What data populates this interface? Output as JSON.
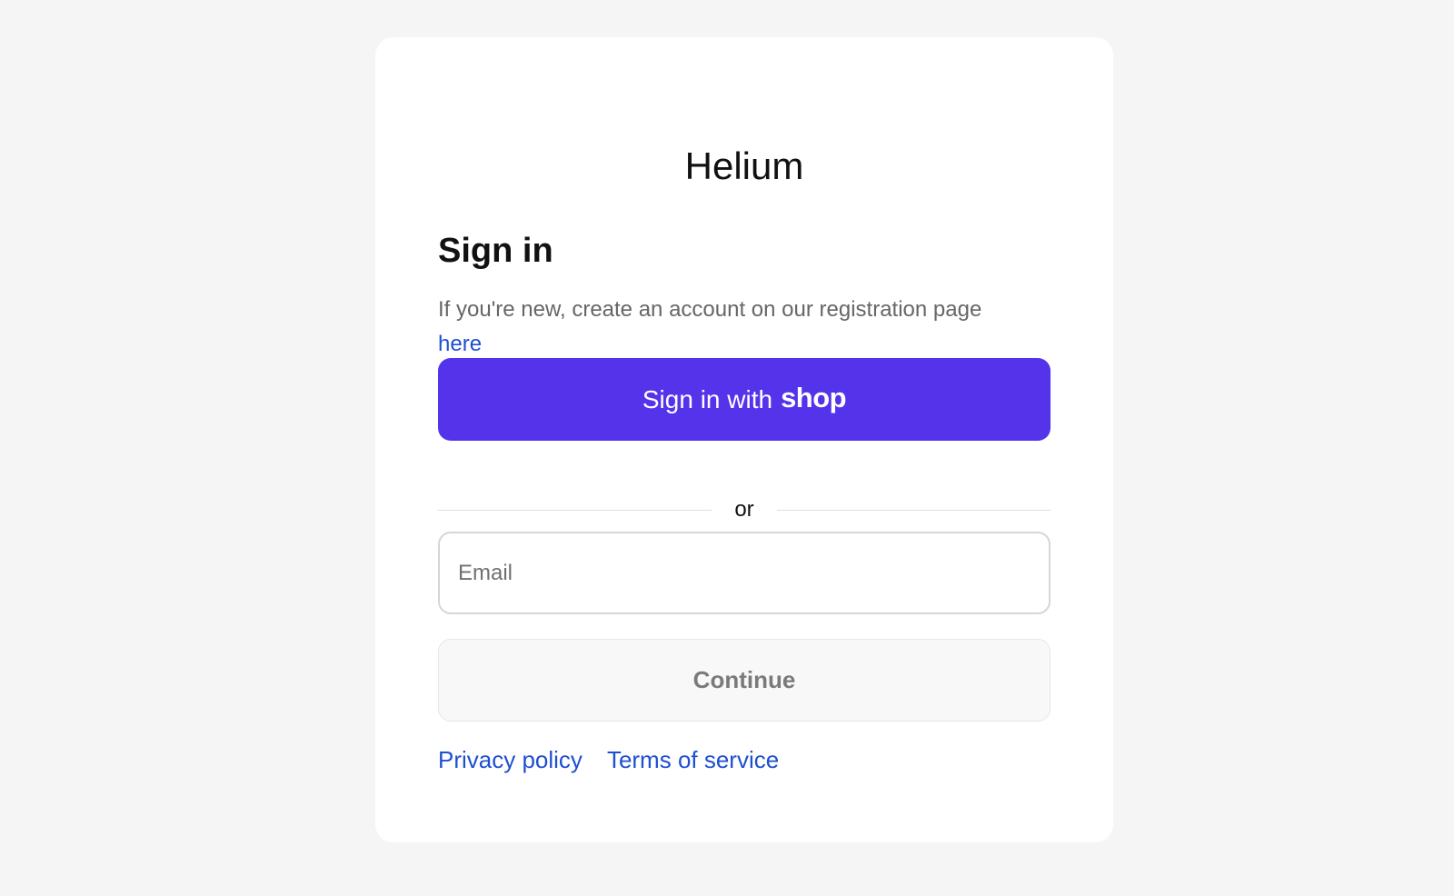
{
  "colors": {
    "page_background": "#f5f5f5",
    "card_background": "#ffffff",
    "shop_accent": "#5433eb",
    "link": "#1f4fd1"
  },
  "brand": {
    "name": "Helium"
  },
  "signin": {
    "heading": "Sign in",
    "intro_text": "If you're new, create an account on our registration page ",
    "intro_link": "here"
  },
  "shop_button": {
    "label": "Sign in with",
    "logo_text": "shop"
  },
  "divider": {
    "label": "or"
  },
  "email": {
    "placeholder": "Email",
    "value": ""
  },
  "continue_button": {
    "label": "Continue",
    "disabled": true
  },
  "footer": {
    "links": [
      "Privacy policy",
      "Terms of service"
    ]
  }
}
